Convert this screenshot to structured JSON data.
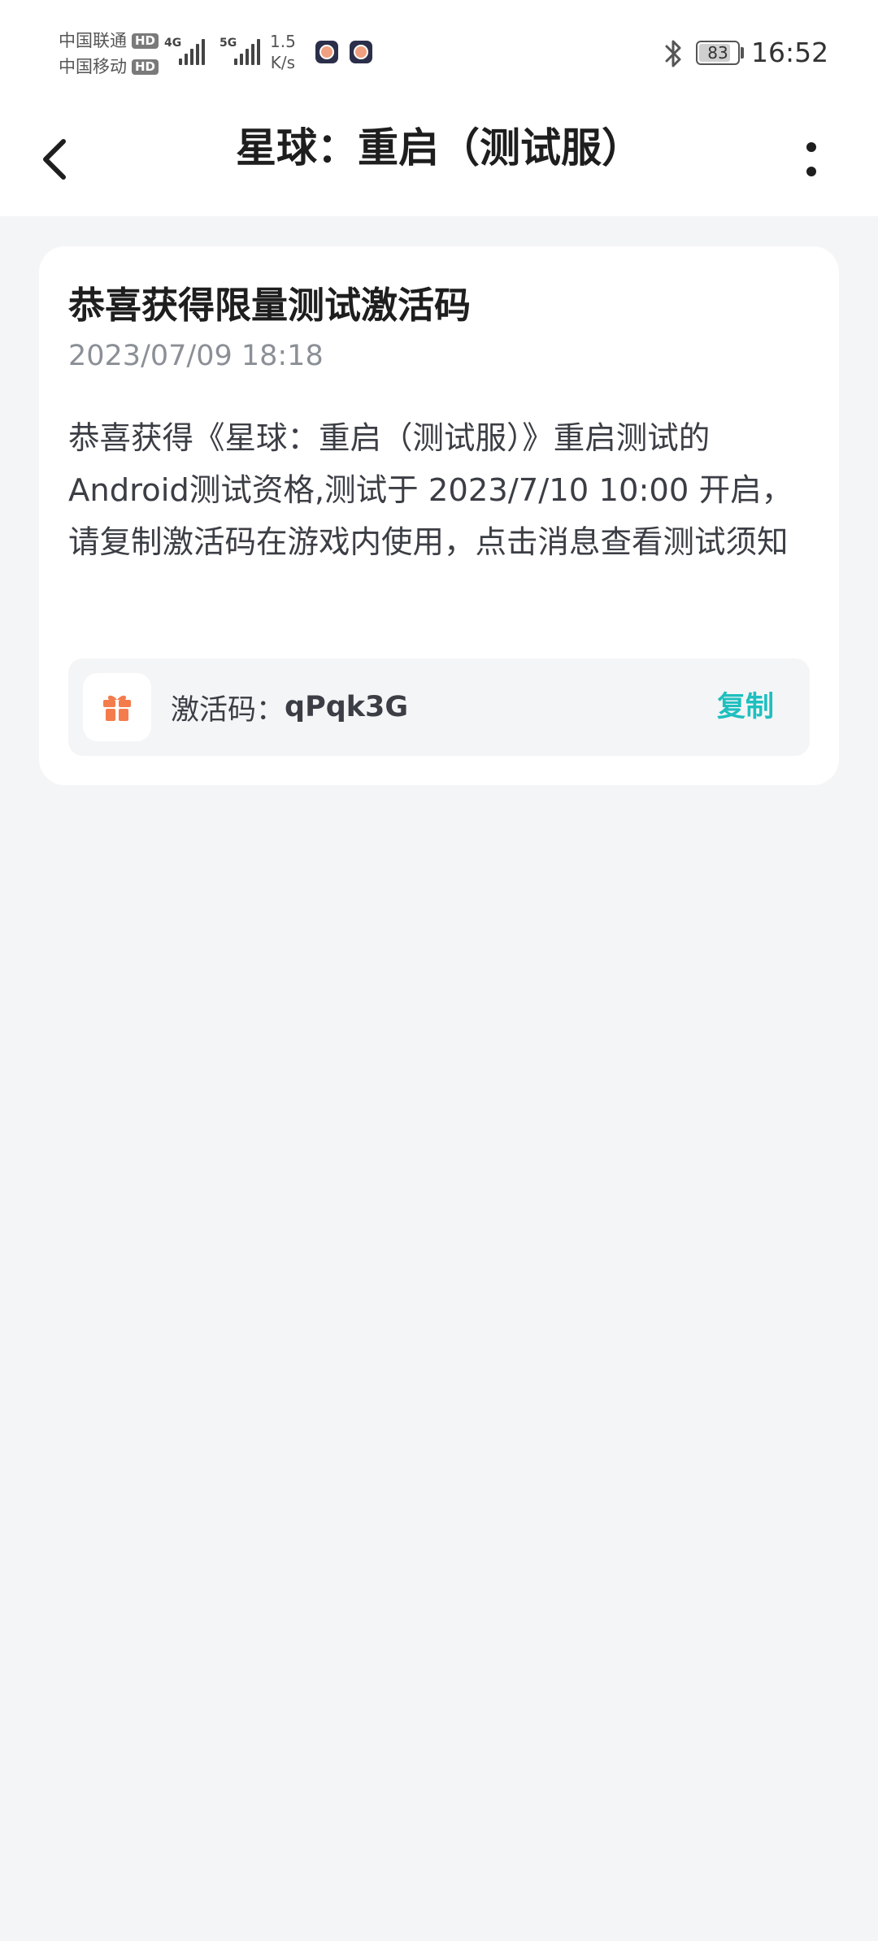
{
  "status_bar": {
    "carrier_1": "中国联通",
    "carrier_2": "中国移动",
    "hd_badge": "HD",
    "network_1": "4G",
    "network_2": "5G",
    "speed_value": "1.5",
    "speed_unit": "K/s",
    "battery_level": "83",
    "time": "16:52"
  },
  "nav": {
    "title": "星球：重启（测试服）"
  },
  "message": {
    "title": "恭喜获得限量测试激活码",
    "date": "2023/07/09 18:18",
    "body": "恭喜获得《星球：重启（测试服）》重启测试的Android测试资格,测试于 2023/7/10 10:00 开启，请复制激活码在游戏内使用，点击消息查看测试须知",
    "code_label": "激活码：",
    "code_value": "qPqk3G",
    "copy_label": "复制"
  },
  "colors": {
    "accent": "#1fbfbf",
    "gift": "#f47c4c",
    "background": "#f4f5f7"
  }
}
